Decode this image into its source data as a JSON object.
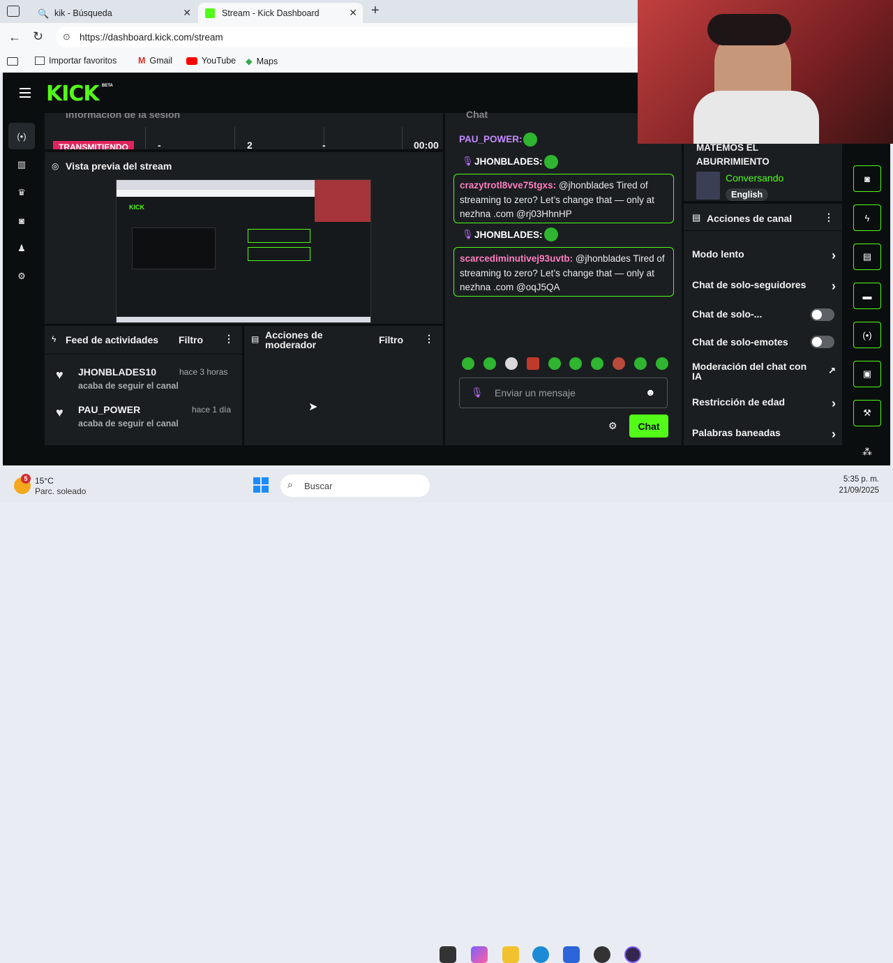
{
  "browser": {
    "tabs": [
      {
        "title": "kik - Búsqueda"
      },
      {
        "title": "Stream - Kick Dashboard"
      }
    ],
    "url": "https://dashboard.kick.com/stream",
    "bookmarks": [
      "Importar favoritos",
      "Gmail",
      "YouTube",
      "Maps"
    ]
  },
  "app": {
    "logo": "KICK",
    "logo_badge": "BETA",
    "session": {
      "title": "Información de la sesión",
      "status": "TRANSMITIENDO",
      "stats": [
        "-",
        "2",
        "-",
        "00:00"
      ]
    },
    "preview": {
      "title": "Vista previa del stream"
    },
    "feed": {
      "title": "Feed de actividades",
      "filter": "Filtro",
      "items": [
        {
          "user": "JHONBLADES10",
          "time": "hace 3 horas",
          "action": "acaba de seguir el canal"
        },
        {
          "user": "PAU_POWER",
          "time": "hace 1 día",
          "action": "acaba de seguir el canal"
        }
      ]
    },
    "mod_actions": {
      "title_1": "Acciones de",
      "title_2": "moderador",
      "filter": "Filtro"
    },
    "chat": {
      "title": "Chat",
      "messages": [
        {
          "user": "PAU_POWER:"
        },
        {
          "user": "JHONBLADES:"
        },
        {
          "user": "crazytrotl8vve75tgxs:",
          "text": "@jhonblades Tired of streaming to zero? Let’s change that — only at nezhna .com @rj03HhnHP"
        },
        {
          "user": "JHONBLADES:"
        },
        {
          "user": "scarcediminutivej93uvtb:",
          "text": "@jhonblades Tired of streaming to zero? Let’s change that — only at nezhna .com @oqJ5QA"
        }
      ],
      "input_placeholder": "Enviar un mensaje",
      "send_label": "Chat"
    },
    "stream_info": {
      "title_1": "MATEMOS EL",
      "title_2": "ABURRIMIENTO",
      "category": "Conversando",
      "language": "English"
    },
    "channel_actions": {
      "title": "Acciones de canal",
      "items": [
        {
          "label": "Modo lento"
        },
        {
          "label": "Chat de solo-seguidores"
        },
        {
          "label": "Chat de solo-..."
        },
        {
          "label": "Chat de solo-emotes"
        },
        {
          "label": "Moderación del chat con IA"
        },
        {
          "label": "Restricción de edad"
        },
        {
          "label": "Palabras baneadas"
        }
      ]
    }
  },
  "taskbar": {
    "weather_temp": "15°C",
    "weather_desc": "Parc. soleado",
    "weather_badge": "5",
    "search": "Buscar",
    "time": "5:35 p. m.",
    "date": "21/09/2025"
  },
  "colors": {
    "accent": "#53fc18",
    "bg": "#0b0e0f",
    "panel": "#1a1e21",
    "live": "#e0245e"
  }
}
